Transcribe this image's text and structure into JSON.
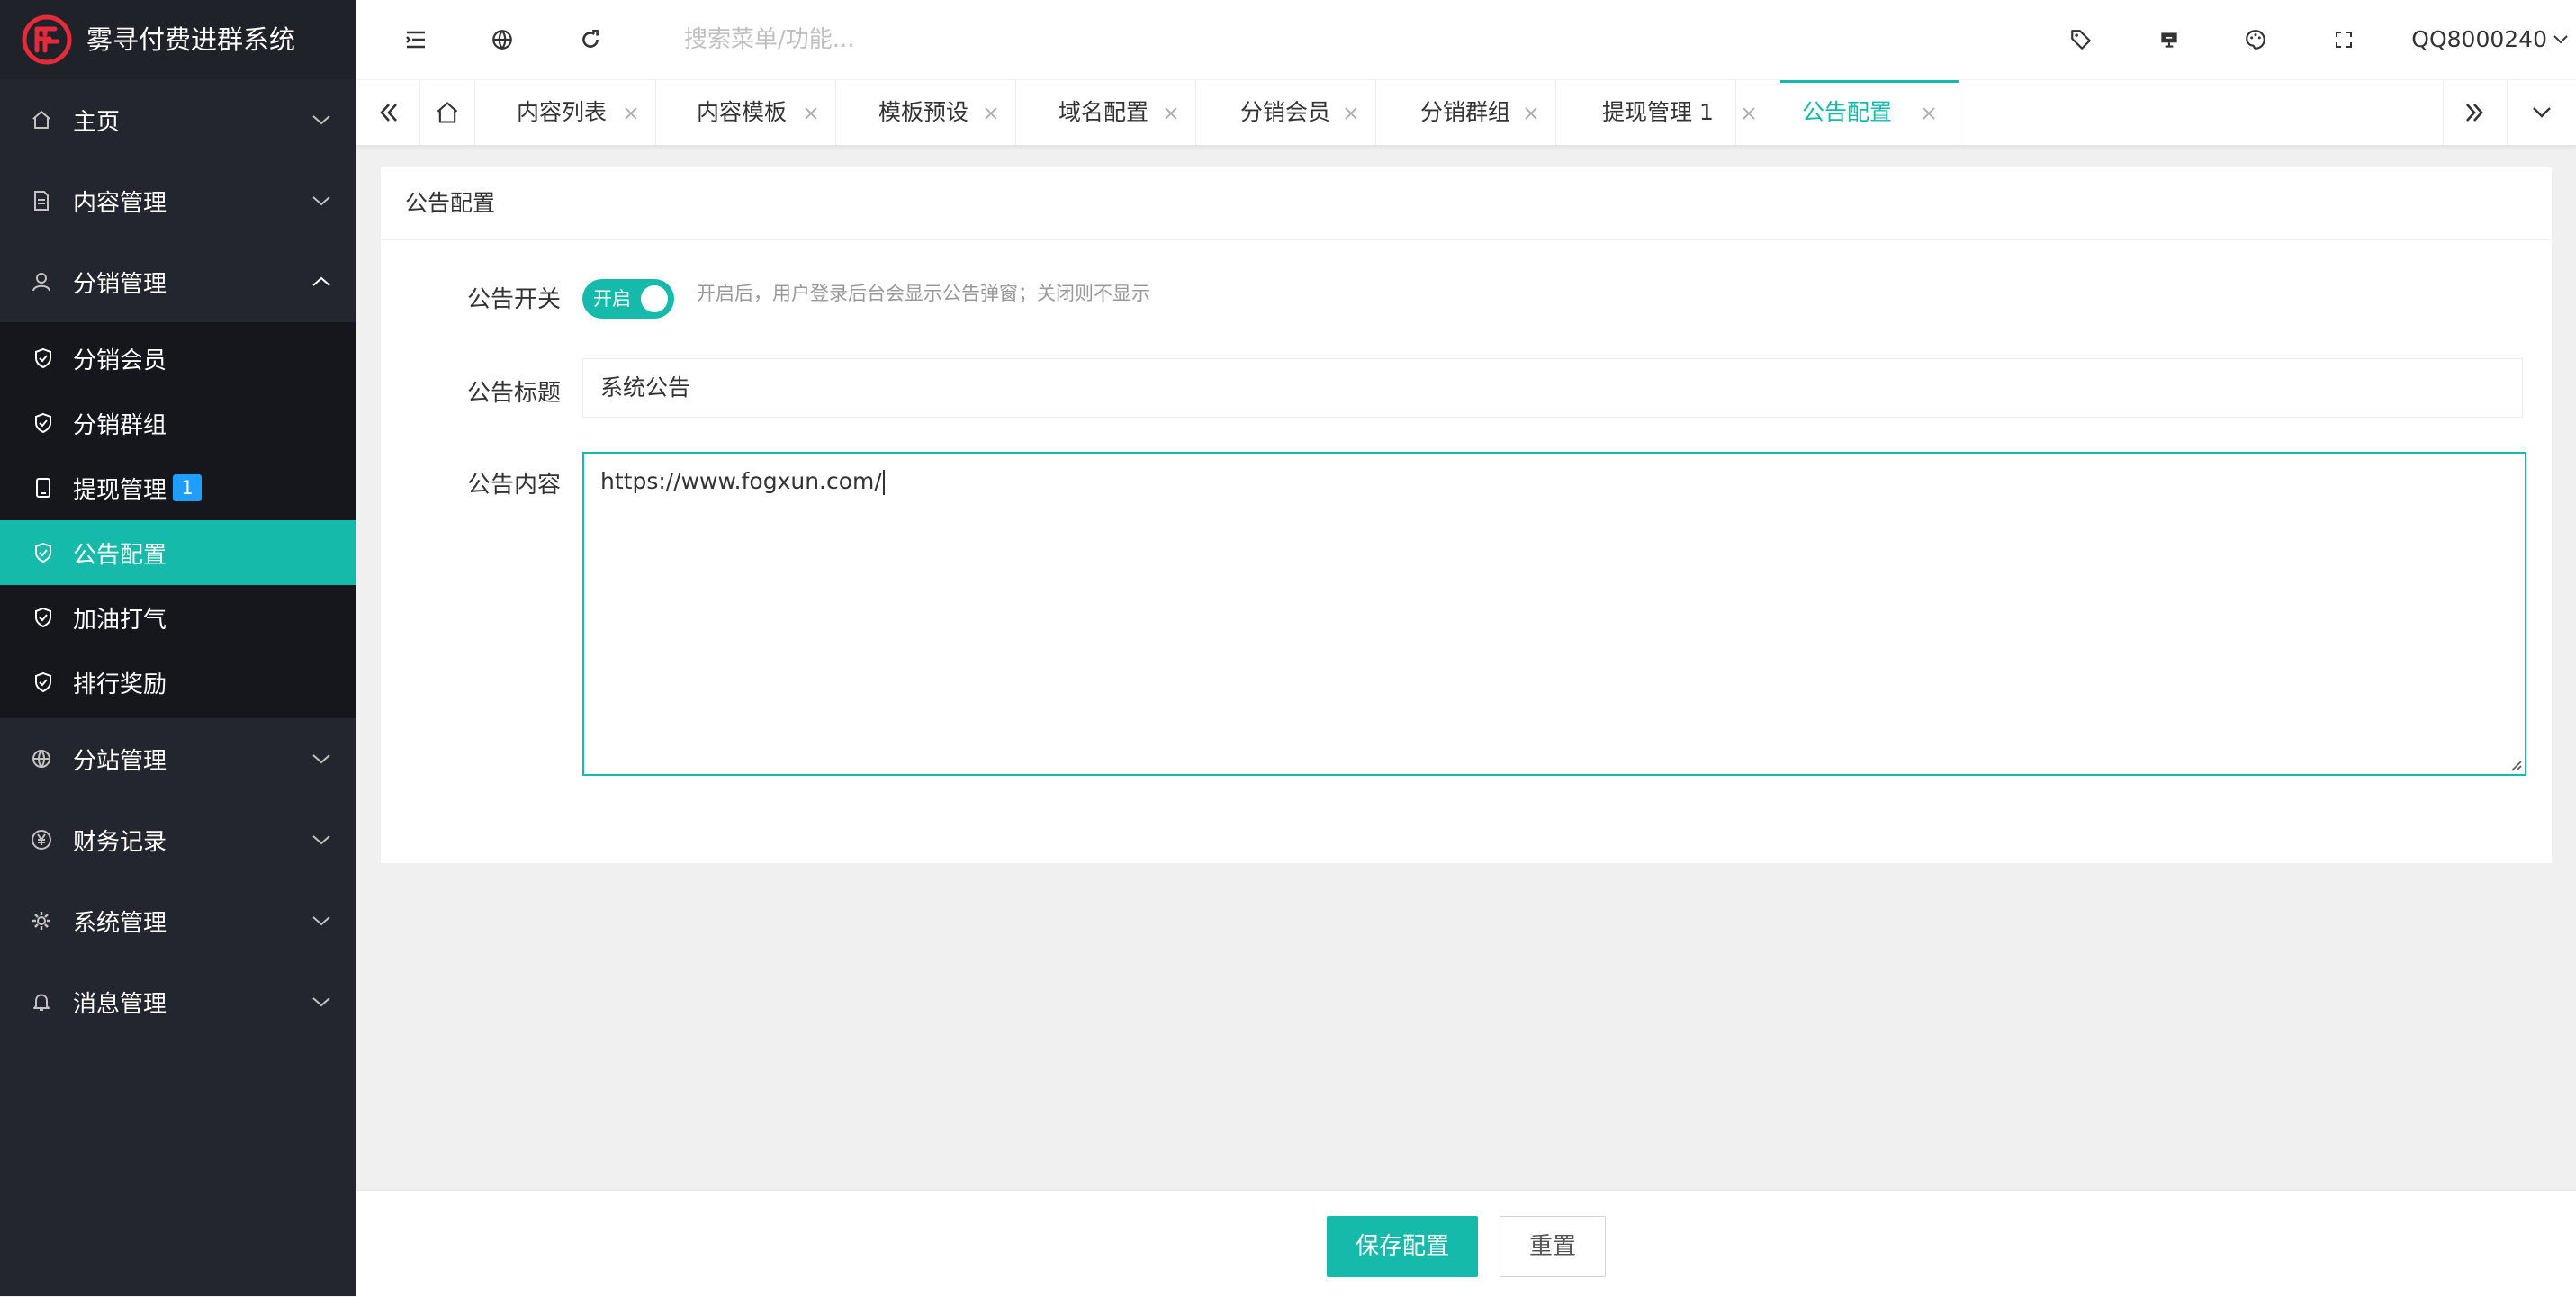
{
  "app": {
    "title": "雾寻付费进群系统",
    "logo_icon": "brand-logo-icon",
    "colors": {
      "accent": "#16baaa",
      "sidebar_bg": "#23262e",
      "submenu_bg": "#15171c",
      "badge": "#1e9fff",
      "logo": "#e32b3b"
    }
  },
  "sidebar": {
    "menu": [
      {
        "label": "主页",
        "icon": "home-icon",
        "expanded": false
      },
      {
        "label": "内容管理",
        "icon": "document-icon",
        "expanded": false
      },
      {
        "label": "分销管理",
        "icon": "user-icon",
        "expanded": true,
        "children": [
          {
            "label": "分销会员",
            "icon": "shield-check-icon"
          },
          {
            "label": "分销群组",
            "icon": "shield-check-icon"
          },
          {
            "label": "提现管理",
            "icon": "tablet-icon",
            "badge": "1"
          },
          {
            "label": "公告配置",
            "icon": "shield-check-icon",
            "active": true
          },
          {
            "label": "加油打气",
            "icon": "shield-check-icon"
          },
          {
            "label": "排行奖励",
            "icon": "shield-check-icon"
          }
        ]
      },
      {
        "label": "分站管理",
        "icon": "globe-icon",
        "expanded": false
      },
      {
        "label": "财务记录",
        "icon": "yen-icon",
        "expanded": false
      },
      {
        "label": "系统管理",
        "icon": "gear-icon",
        "expanded": false
      },
      {
        "label": "消息管理",
        "icon": "bell-icon",
        "expanded": false
      }
    ]
  },
  "header": {
    "search_placeholder": "搜索菜单/功能...",
    "user": "QQ8000240"
  },
  "tabs": [
    {
      "label": "内容列表"
    },
    {
      "label": "内容模板"
    },
    {
      "label": "模板预设"
    },
    {
      "label": "域名配置"
    },
    {
      "label": "分销会员"
    },
    {
      "label": "分销群组"
    },
    {
      "label": "提现管理 1"
    },
    {
      "label": "公告配置",
      "active": true
    }
  ],
  "form": {
    "card_title": "公告配置",
    "switch_label": "公告开关",
    "switch_text": "开启",
    "switch_on": true,
    "switch_tip": "开启后，用户登录后台会显示公告弹窗；关闭则不显示",
    "title_label": "公告标题",
    "title_value": "系统公告",
    "content_label": "公告内容",
    "content_value": "https://www.fogxun.com/"
  },
  "footer": {
    "save_label": "保存配置",
    "reset_label": "重置"
  }
}
